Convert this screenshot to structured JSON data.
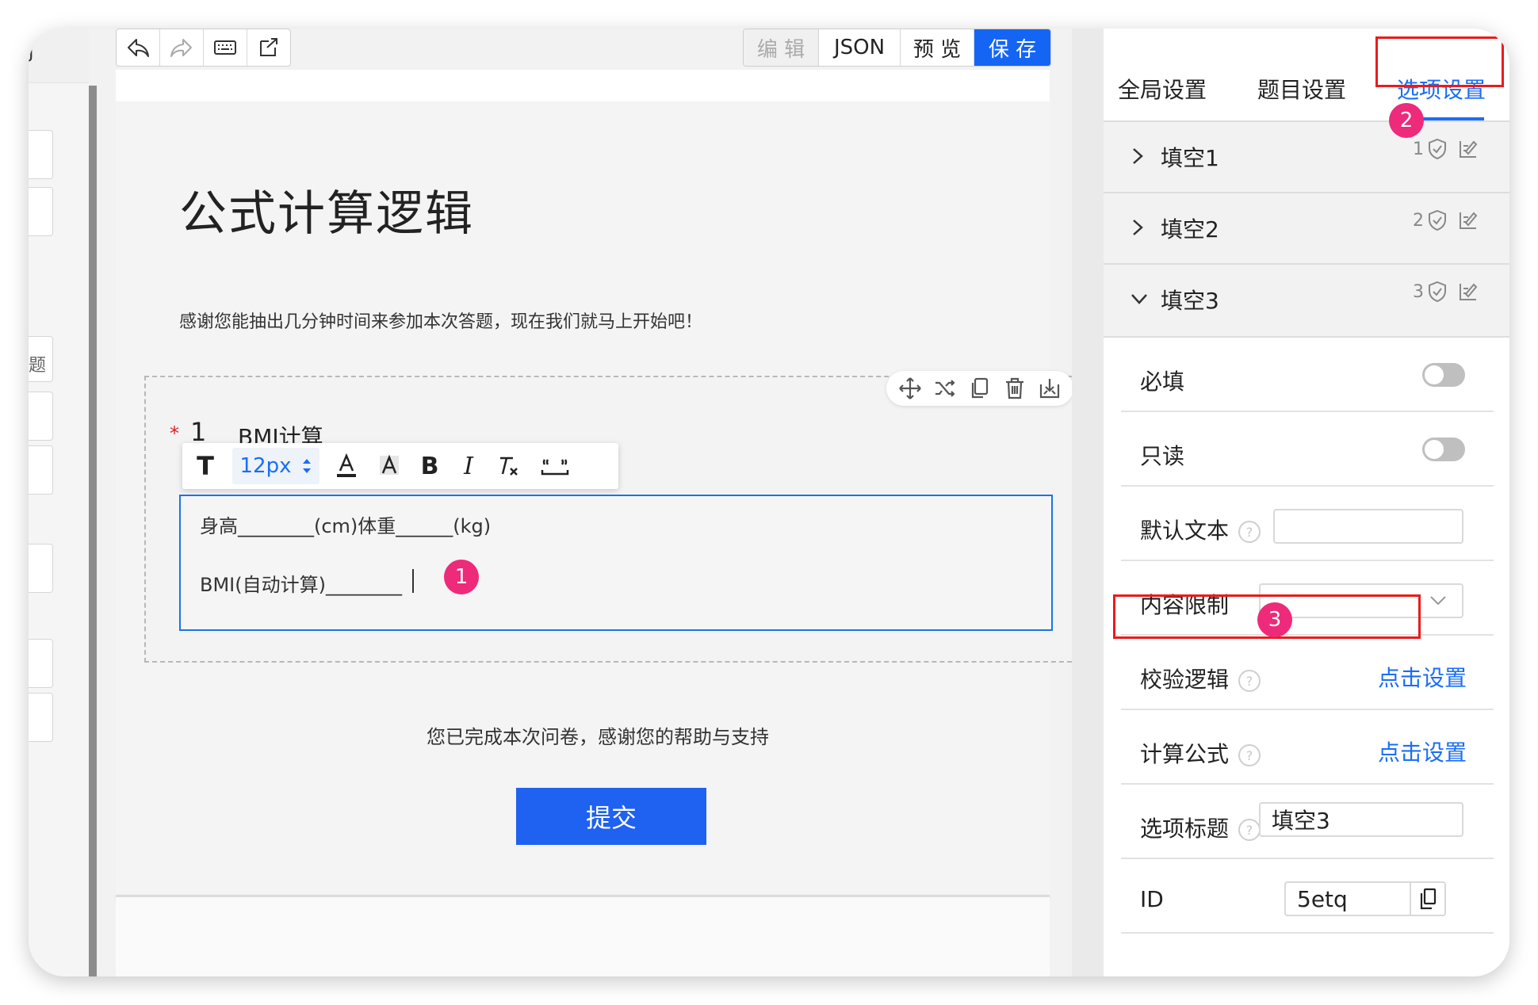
{
  "left_strip": {
    "top_char": "J",
    "partial_label": "题"
  },
  "toolbar": {
    "undo_icon": "undo-icon",
    "redo_icon": "redo-icon",
    "keyboard_icon": "keyboard-icon",
    "export_icon": "export-icon",
    "edit_label": "编 辑",
    "json_label": "JSON",
    "preview_label": "预 览",
    "save_label": "保 存"
  },
  "survey": {
    "title": "公式计算逻辑",
    "intro": "感谢您能抽出几分钟时间来参加本次答题，现在我们就马上开始吧！",
    "question": {
      "required_mark": "*",
      "number": "1",
      "title": "BMI计算",
      "line1": "身高________(cm)体重______(kg)",
      "line2": "BMI(自动计算)________"
    },
    "format_bar": {
      "text_icon": "T",
      "font_size": "12px",
      "bold": "B",
      "italic": "I"
    },
    "thanks": "您已完成本次问卷，感谢您的帮助与支持",
    "submit_label": "提交"
  },
  "badges": {
    "b1": "1",
    "b2": "2",
    "b3": "3"
  },
  "panel": {
    "tabs": [
      "全局设置",
      "题目设置",
      "选项设置"
    ],
    "blanks": [
      {
        "label": "填空1",
        "count": "1"
      },
      {
        "label": "填空2",
        "count": "2"
      },
      {
        "label": "填空3",
        "count": "3"
      }
    ],
    "props": {
      "required": "必填",
      "readonly": "只读",
      "default_text": "默认文本",
      "content_limit": "内容限制",
      "validation": "校验逻辑",
      "validation_link": "点击设置",
      "formula": "计算公式",
      "formula_link": "点击设置",
      "option_title": "选项标题",
      "option_title_value": "填空3",
      "id_label": "ID",
      "id_value": "5etq"
    }
  },
  "colors": {
    "accent": "#1a6ef5",
    "submit": "#1f61f0",
    "badge": "#ee2a7a",
    "highlight": "#ea1b1b"
  }
}
